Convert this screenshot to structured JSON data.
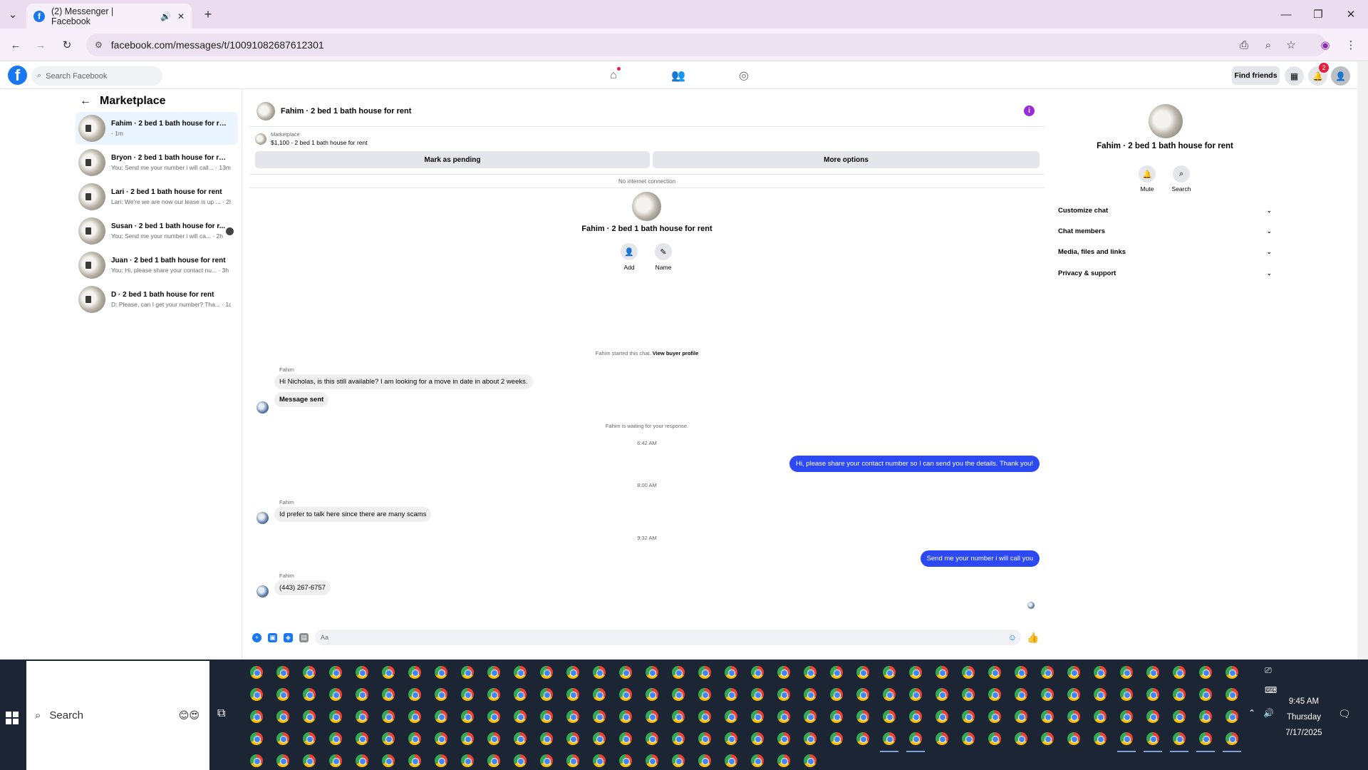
{
  "browser": {
    "tab_title": "(2) Messenger | Facebook",
    "url": "facebook.com/messages/t/10091082687612301"
  },
  "fb": {
    "search_placeholder": "Search Facebook",
    "find_friends": "Find friends",
    "notification_count": "2",
    "brand_color": "#1877f2"
  },
  "sidebar": {
    "title": "Marketplace",
    "conversations": [
      {
        "name": "Fahim · 2 bed 1 bath house for rent",
        "preview": "· 1m"
      },
      {
        "name": "Bryon · 2 bed 1 bath house for rent",
        "preview": "You: Send me your number i will call... · 13m"
      },
      {
        "name": "Lari · 2 bed 1 bath house for rent",
        "preview": "Lari: We're we are now our lease is up ... · 2h"
      },
      {
        "name": "Susan · 2 bed 1 bath house for r...",
        "preview": "You: Send me your number i will ca... · 2h"
      },
      {
        "name": "Juan · 2 bed 1 bath house for rent",
        "preview": "You: Hi, please share your contact nu... · 3h"
      },
      {
        "name": "D · 2 bed 1 bath house for rent",
        "preview": "D: Please, can I get your number? Tha... · 1d"
      }
    ]
  },
  "chat": {
    "header_title": "Fahim · 2 bed 1 bath house for rent",
    "marketplace_label": "Marketplace",
    "listing": "$1,100 - 2 bed 1 bath house for rent",
    "mark_pending": "Mark as pending",
    "more_options": "More options",
    "no_internet": "No internet connection",
    "center_name": "Fahim · 2 bed 1 bath house for rent",
    "add_label": "Add",
    "name_label": "Name",
    "started_text": "Fahim started this chat.",
    "view_profile": "View buyer profile",
    "sender": "Fahim",
    "msg1": "Hi Nicholas, is this still available? I am looking for a move in date in about 2 weeks.",
    "msg2": "Message sent",
    "waiting": "Fahim is waiting for your response.",
    "time1": "6:42 AM",
    "out1": "Hi, please share your contact number so I can send you the details. Thank you!",
    "time2": "8:00 AM",
    "msg3": "Id prefer to talk here since there are many scams",
    "time3": "9:32 AM",
    "out2": "Send me your number i will call you",
    "msg4": "(443) 267-6757",
    "composer_placeholder": "Aa"
  },
  "panel": {
    "name": "Fahim · 2 bed 1 bath house for rent",
    "mute": "Mute",
    "search": "Search",
    "sections": [
      "Customize chat",
      "Chat members",
      "Media, files and links",
      "Privacy & support"
    ]
  },
  "taskbar": {
    "search": "Search",
    "time": "9:45 AM",
    "day": "Thursday",
    "date": "7/17/2025"
  }
}
